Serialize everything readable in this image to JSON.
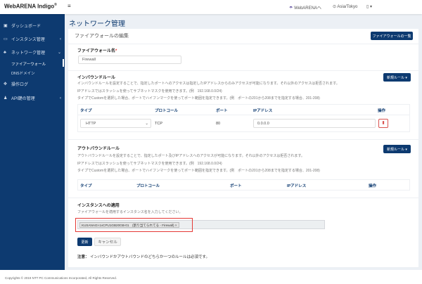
{
  "topbar": {
    "brand": "WebARENA Indigo",
    "reg": "®",
    "menu_icon": "≡",
    "link": "WebARENAへ",
    "timezone": "Asia/Tokyo"
  },
  "sidebar": {
    "items": [
      {
        "label": "ダッシュボード",
        "icon": "dashboard-icon"
      },
      {
        "label": "インスタンス管理",
        "icon": "monitor-icon"
      },
      {
        "label": "ネットワーク管理",
        "icon": "network-icon"
      },
      {
        "label": "操作ログ",
        "icon": "log-icon"
      },
      {
        "label": "API鍵の管理",
        "icon": "key-icon"
      }
    ],
    "sub": [
      "ファイアーウォール",
      "DNSドメイン"
    ]
  },
  "page": {
    "title": "ネットワーク管理"
  },
  "card": {
    "title": "ファイアウォールの編集",
    "list_button": "ファイアウォールの一覧",
    "name_label": "ファイアウォール名",
    "required": "*",
    "name_value": "Firewall",
    "inbound": {
      "title": "インバウンドルール",
      "new_rule": "新規ルール ▾",
      "desc": [
        "インバウンドルールを設定することで、指定したポートへのアクセスは指定したIPアドレスからのみアクセスが可能になります。それ以外のアクセスは拒否されます。",
        "IPアドレスではスラッシュを使ってサブネットマスクを使用できます。(例　192.168.0.0/24)",
        "タイプでCustomを選択した場合、ポートでハイフンマークを使ってポート範囲を指定できます。(例　ポートの201から208までを指定する場合、201-208)"
      ],
      "headers": [
        "タイプ",
        "プロトコール",
        "ポート",
        "IPアドレス",
        "操作"
      ],
      "row": {
        "type": "HTTP",
        "protocol": "TCP",
        "port": "80",
        "ip": "0.0.0.0"
      }
    },
    "outbound": {
      "title": "アウトバウンドルール",
      "new_rule": "新規ルール ▾",
      "desc": [
        "アウトバウンドルールを設定することで、指定したポート及びIPアドレスへのアクセスが可能になります。それ以外のアクセスは拒否されます。",
        "IPアドレスではスラッシュを使ってサブネットマスクを使用できます。(例　192.168.0.0/24)",
        "タイプでCustomを選択した場合、ポートでハイフンマークを使ってポート範囲を指定できます。(例　ポートの201から208までを指定する場合、201-208)"
      ],
      "headers": [
        "タイプ",
        "プロトコール",
        "ポート",
        "IPアドレス",
        "操作"
      ]
    },
    "instances": {
      "title": "インスタンスへの適用",
      "desc": "ファイアウォールを適用するインスタンス名を入力してください。",
      "tag": "KUSANAGI-1vCPU1GB20GB-01　(割り当てられてる - Firewall)",
      "tag_close": "×"
    },
    "update": "更新",
    "cancel": "キャンセル",
    "note_label": "注意：",
    "note": "インバウンドかアウトバウンドのどちらか一つのルールは必須です。"
  },
  "footer": "Copyrights © 2019 NTT PC Communications Incorporated, All Rights Reserved.",
  "colors": {
    "primary": "#0d3a70",
    "highlight": "#e53935",
    "danger": "#d9534f"
  }
}
